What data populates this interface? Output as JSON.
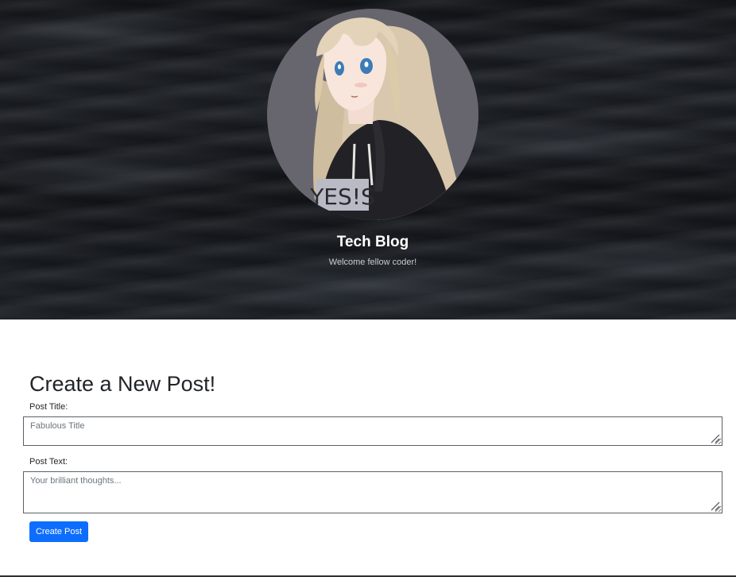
{
  "header": {
    "title": "Tech Blog",
    "tagline": "Welcome fellow coder!",
    "avatar_shirt_text": "YES!S"
  },
  "form": {
    "heading": "Create a New Post!",
    "title_label": "Post Title:",
    "title_placeholder": "Fabulous Title",
    "title_value": "",
    "text_label": "Post Text:",
    "text_placeholder": "Your brilliant thoughts...",
    "text_value": "",
    "submit_label": "Create Post"
  },
  "colors": {
    "accent": "#0d6efd",
    "avatar_background": "#67666e",
    "hero_background": "#15181c"
  }
}
